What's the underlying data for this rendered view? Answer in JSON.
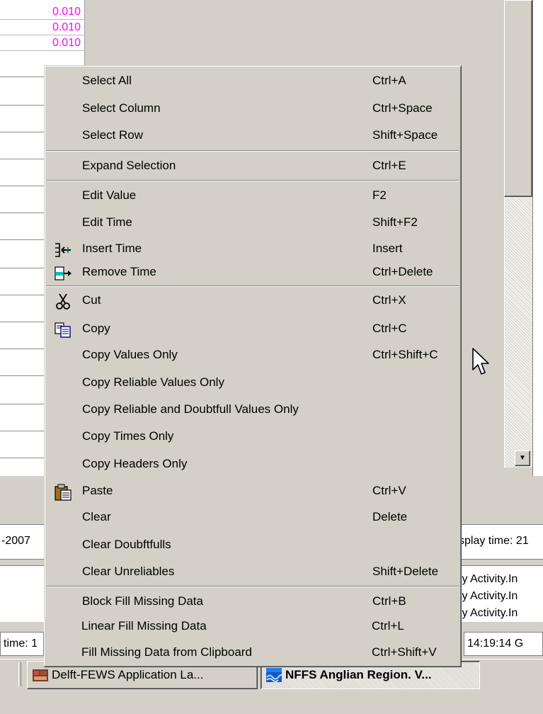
{
  "table": {
    "visible_values": [
      "0.010",
      "0.010",
      "0.010"
    ]
  },
  "status": {
    "left_date_fragment": "-2007",
    "display_time_fragment": "splay time: 21",
    "log_lines": [
      "ty Activity.In",
      "ty Activity.In",
      "ty Activity.In"
    ],
    "time_left": "time: 1",
    "time_right": "14:19:14 G"
  },
  "context_menu": {
    "items": [
      {
        "label": "Select All",
        "shortcut": "Ctrl+A"
      },
      {
        "label": "Select Column",
        "shortcut": "Ctrl+Space"
      },
      {
        "label": "Select Row",
        "shortcut": "Shift+Space"
      },
      {
        "label": "Expand Selection",
        "shortcut": "Ctrl+E"
      },
      {
        "label": "Edit Value",
        "shortcut": "F2"
      },
      {
        "label": "Edit Time",
        "shortcut": "Shift+F2"
      },
      {
        "label": "Insert Time",
        "shortcut": "Insert",
        "icon": "insert-time-icon"
      },
      {
        "label": "Remove Time",
        "shortcut": "Ctrl+Delete",
        "icon": "remove-time-icon"
      },
      {
        "label": "Cut",
        "shortcut": "Ctrl+X",
        "icon": "scissors-icon"
      },
      {
        "label": "Copy",
        "shortcut": "Ctrl+C",
        "icon": "copy-icon"
      },
      {
        "label": "Copy Values Only",
        "shortcut": "Ctrl+Shift+C"
      },
      {
        "label": "Copy Reliable Values Only",
        "shortcut": ""
      },
      {
        "label": "Copy Reliable and Doubtfull Values Only",
        "shortcut": ""
      },
      {
        "label": "Copy Times Only",
        "shortcut": ""
      },
      {
        "label": "Copy Headers Only",
        "shortcut": ""
      },
      {
        "label": "Paste",
        "shortcut": "Ctrl+V",
        "icon": "paste-icon"
      },
      {
        "label": "Clear",
        "shortcut": "Delete"
      },
      {
        "label": "Clear Doubftfulls",
        "shortcut": ""
      },
      {
        "label": "Clear Unreliables",
        "shortcut": "Shift+Delete"
      },
      {
        "label": "Block Fill Missing Data",
        "shortcut": "Ctrl+B"
      },
      {
        "label": "Linear Fill Missing Data",
        "shortcut": "Ctrl+L"
      },
      {
        "label": "Fill Missing Data from Clipboard",
        "shortcut": "Ctrl+Shift+V"
      }
    ]
  },
  "taskbar": {
    "buttons": [
      {
        "label": "Delft-FEWS Application La...",
        "icon": "fews-launcher-icon",
        "active": false
      },
      {
        "label": "NFFS Anglian Region. V...",
        "icon": "nffs-app-icon",
        "active": true
      }
    ]
  },
  "colors": {
    "menu_bg": "#d4d0c8",
    "value_text": "#ff00ff",
    "window_bg": "#ffffff"
  }
}
